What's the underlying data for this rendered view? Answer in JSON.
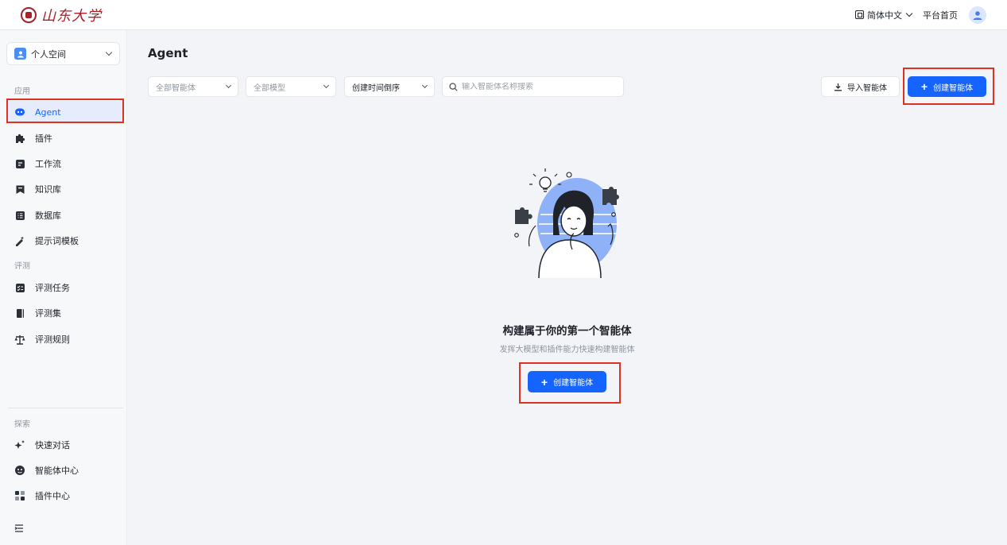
{
  "header": {
    "brand_name": "山东大学",
    "language": "简体中文",
    "platform_home": "平台首页"
  },
  "sidebar": {
    "space_selector": "个人空间",
    "sections": {
      "apps": "应用",
      "eval": "评测",
      "explore": "探索"
    },
    "apps_items": [
      {
        "label": "Agent",
        "icon": "bot-icon"
      },
      {
        "label": "插件",
        "icon": "puzzle-icon"
      },
      {
        "label": "工作流",
        "icon": "workflow-icon"
      },
      {
        "label": "知识库",
        "icon": "knowledge-icon"
      },
      {
        "label": "数据库",
        "icon": "database-icon"
      },
      {
        "label": "提示词模板",
        "icon": "prompt-icon"
      }
    ],
    "eval_items": [
      {
        "label": "评测任务",
        "icon": "task-icon"
      },
      {
        "label": "评测集",
        "icon": "book-icon"
      },
      {
        "label": "评测规则",
        "icon": "scale-icon"
      }
    ],
    "explore_items": [
      {
        "label": "快速对话",
        "icon": "sparkle-icon"
      },
      {
        "label": "智能体中心",
        "icon": "agent-hub-icon"
      },
      {
        "label": "插件中心",
        "icon": "plugin-hub-icon"
      }
    ]
  },
  "main": {
    "title": "Agent",
    "filters": {
      "agent_scope": "全部智能体",
      "model": "全部模型",
      "sort": "创建时间倒序"
    },
    "search_placeholder": "输入智能体名称搜索",
    "import_label": "导入智能体",
    "create_label": "创建智能体",
    "empty_title": "构建属于你的第一个智能体",
    "empty_subtitle": "发挥大模型和插件能力快速构建智能体",
    "empty_create_label": "创建智能体"
  },
  "colors": {
    "primary": "#1664ff",
    "highlight": "#e0301e",
    "brand": "#a8202a"
  }
}
